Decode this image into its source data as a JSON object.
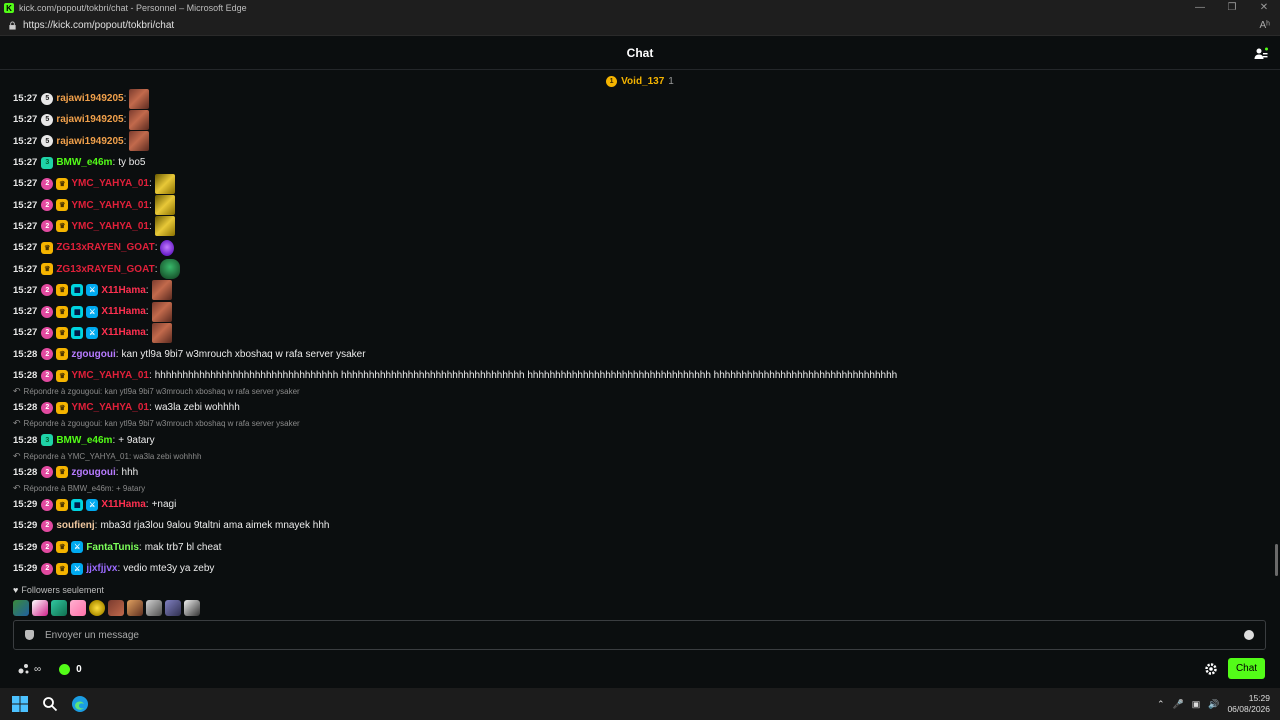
{
  "browser": {
    "window_title": "kick.com/popout/tokbri/chat - Personnel – Microsoft Edge",
    "url": "https://kick.com/popout/tokbri/chat",
    "reader_label": "Aʰ"
  },
  "header": {
    "title": "Chat"
  },
  "pinned": {
    "name": "Void_137",
    "count": "1"
  },
  "colors": {
    "orange": "#e98b2a",
    "green": "#53fc18",
    "red": "#ff3b3b",
    "purple": "#a66bff",
    "pink": "#ff4a8d",
    "cyan": "#38c6ff",
    "accent": "#53fc18",
    "gold": "#f5b400"
  },
  "messages": [
    {
      "time": "15:27",
      "user": "rajawi1949205",
      "color": "#f0a04b",
      "text": ""
    },
    {
      "time": "15:27",
      "user": "rajawi1949205",
      "color": "#f0a04b",
      "text": ""
    },
    {
      "time": "15:27",
      "user": "rajawi1949205",
      "color": "#f0a04b",
      "text": ""
    },
    {
      "time": "15:27",
      "user": "BMW_e46m",
      "color": "#53fc18",
      "text": "ty bo5"
    },
    {
      "time": "15:27",
      "user": "YMC_YAHYA_01",
      "color": "#e0203a",
      "text": ""
    },
    {
      "time": "15:27",
      "user": "YMC_YAHYA_01",
      "color": "#e0203a",
      "text": ""
    },
    {
      "time": "15:27",
      "user": "YMC_YAHYA_01",
      "color": "#e0203a",
      "text": ""
    },
    {
      "time": "15:27",
      "user": "ZG13xRAYEN_GOAT",
      "color": "#e0203a",
      "text": ""
    },
    {
      "time": "15:27",
      "user": "ZG13xRAYEN_GOAT",
      "color": "#e0203a",
      "text": ""
    },
    {
      "time": "15:27",
      "user": "X11Hama",
      "color": "#ff3050",
      "text": ""
    },
    {
      "time": "15:27",
      "user": "X11Hama",
      "color": "#ff3050",
      "text": ""
    },
    {
      "time": "15:27",
      "user": "X11Hama",
      "color": "#ff3050",
      "text": ""
    },
    {
      "time": "15:28",
      "user": "zgougoui",
      "color": "#b77bff",
      "text": "kan ytl9a 9bi7 w3mrouch xboshaq w rafa server ysaker"
    },
    {
      "time": "15:28",
      "user": "YMC_YAHYA_01",
      "color": "#e0203a",
      "text": "hhhhhhhhhhhhhhhhhhhhhhhhhhhhhhhhh hhhhhhhhhhhhhhhhhhhhhhhhhhhhhhhhh hhhhhhhhhhhhhhhhhhhhhhhhhhhhhhhhh hhhhhhhhhhhhhhhhhhhhhhhhhhhhhhhhh"
    },
    {
      "reply": "Répondre à zgougoui: kan ytl9a 9bi7 w3mrouch xboshaq w rafa server ysaker"
    },
    {
      "time": "15:28",
      "user": "YMC_YAHYA_01",
      "color": "#e0203a",
      "text": "wa3la zebi wohhhh"
    },
    {
      "reply": "Répondre à zgougoui: kan ytl9a 9bi7 w3mrouch xboshaq w rafa server ysaker"
    },
    {
      "time": "15:28",
      "user": "BMW_e46m",
      "color": "#53fc18",
      "text": "+ 9atary"
    },
    {
      "reply": "Répondre à YMC_YAHYA_01: wa3la zebi wohhhh"
    },
    {
      "time": "15:28",
      "user": "zgougoui",
      "color": "#b77bff",
      "text": "hhh"
    },
    {
      "reply": "Répondre à BMW_e46m: + 9atary"
    },
    {
      "time": "15:29",
      "user": "X11Hama",
      "color": "#ff3050",
      "text": "+nagi"
    },
    {
      "time": "15:29",
      "user": "soufienj",
      "color": "#f0c8a0",
      "text": "mba3d rja3lou 9alou 9taltni ama aimek mnayek hhh"
    },
    {
      "time": "15:29",
      "user": "FantaTunis",
      "color": "#7cff5a",
      "text": "mak trb7 bl cheat"
    },
    {
      "time": "15:29",
      "user": "jjxfjjvx",
      "color": "#9b6bff",
      "text": "vedio mte3y ya zeby"
    }
  ],
  "followers_label": "Followers seulement",
  "input": {
    "placeholder": "Envoyer un message"
  },
  "bottom": {
    "points": "∞",
    "coins": "0",
    "chat_button": "Chat"
  },
  "taskbar": {
    "time": "15:29",
    "date": "06/08/2026"
  }
}
